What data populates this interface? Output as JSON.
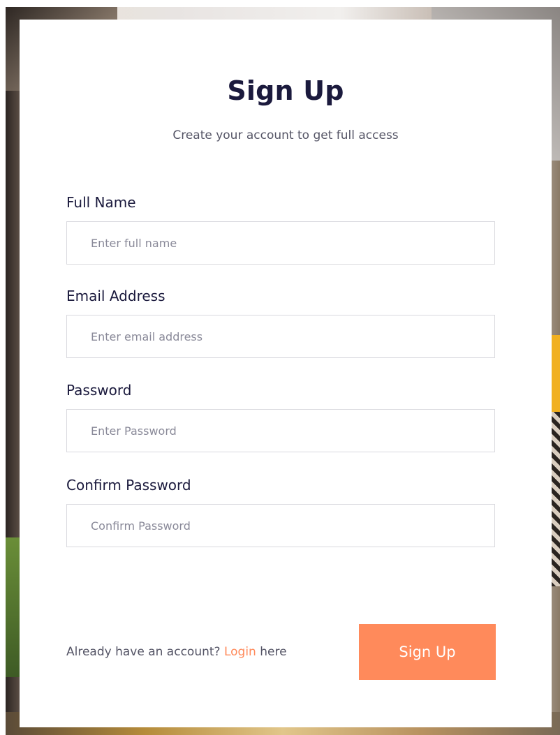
{
  "form": {
    "title": "Sign Up",
    "subtitle": "Create your account to get full access",
    "fields": [
      {
        "label": "Full Name",
        "placeholder": "Enter full name",
        "value": ""
      },
      {
        "label": "Email Address",
        "placeholder": "Enter email address",
        "value": ""
      },
      {
        "label": "Password",
        "placeholder": "Enter Password",
        "value": ""
      },
      {
        "label": "Confirm Password",
        "placeholder": "Confirm Password",
        "value": ""
      }
    ],
    "footer": {
      "prefix": "Already have an account?",
      "link_label": "Login",
      "suffix": "here"
    },
    "submit_label": "Sign Up"
  },
  "colors": {
    "accent": "#ff8a5b",
    "heading": "#1b1a3d",
    "muted": "#555566",
    "border": "#d9d9de"
  }
}
